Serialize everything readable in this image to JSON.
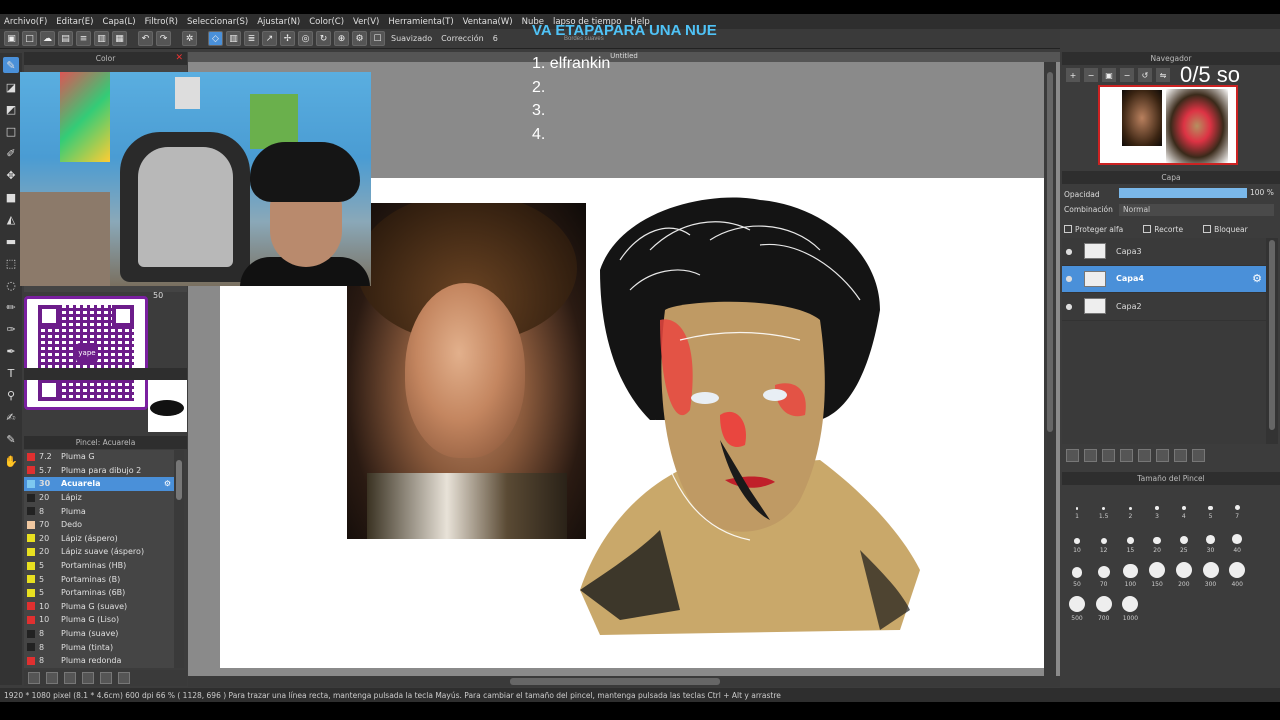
{
  "menu": [
    "Archivo(F)",
    "Editar(E)",
    "Capa(L)",
    "Filtro(R)",
    "Seleccionar(S)",
    "Ajustar(N)",
    "Color(C)",
    "Ver(V)",
    "Herramienta(T)",
    "Ventana(W)",
    "Nube",
    "lapso de tiempo",
    "Help"
  ],
  "toolbar": {
    "smoothing_label": "Suavizado",
    "correction_label": "Corrección",
    "correction_value": "6"
  },
  "color_panel": {
    "title": "Color"
  },
  "canvas": {
    "title": "Untitled"
  },
  "overlay": {
    "title": "VA ETAPAPARA UNA NUE",
    "subtitle": "Bordes suaves",
    "list": [
      "1. elfrankin",
      "2.",
      "3.",
      "4."
    ],
    "score": "0/5 so"
  },
  "qr": {
    "brand": "yape"
  },
  "brush_size_small": "50",
  "subtool_panel": {
    "title": "Pincel: Acuarela"
  },
  "brushes": [
    {
      "size": "7.2",
      "name": "Pluma G",
      "color": "#e03030"
    },
    {
      "size": "5.7",
      "name": "Pluma para dibujo 2",
      "color": "#e03030"
    },
    {
      "size": "30",
      "name": "Acuarela",
      "color": "#7ec8f0",
      "selected": true
    },
    {
      "size": "20",
      "name": "Lápiz",
      "color": "#222222"
    },
    {
      "size": "8",
      "name": "Pluma",
      "color": "#222222"
    },
    {
      "size": "70",
      "name": "Dedo",
      "color": "#f0c8a0"
    },
    {
      "size": "20",
      "name": "Lápiz (áspero)",
      "color": "#e8e020"
    },
    {
      "size": "20",
      "name": "Lápiz suave (áspero)",
      "color": "#e8e020"
    },
    {
      "size": "5",
      "name": "Portaminas (HB)",
      "color": "#e8e020"
    },
    {
      "size": "5",
      "name": "Portaminas (B)",
      "color": "#e8e020"
    },
    {
      "size": "5",
      "name": "Portaminas (6B)",
      "color": "#e8e020"
    },
    {
      "size": "10",
      "name": "Pluma G (suave)",
      "color": "#e03030"
    },
    {
      "size": "10",
      "name": "Pluma G (Liso)",
      "color": "#e03030"
    },
    {
      "size": "8",
      "name": "Pluma (suave)",
      "color": "#222222"
    },
    {
      "size": "8",
      "name": "Pluma (tinta)",
      "color": "#222222"
    },
    {
      "size": "8",
      "name": "Pluma redonda",
      "color": "#e03030"
    }
  ],
  "navigator": {
    "title": "Navegador"
  },
  "layers": {
    "title": "Capa",
    "opacity_label": "Opacidad",
    "opacity_value": "100 %",
    "opacity_fraction": 1.0,
    "blend_label": "Combinación",
    "blend_value": "Normal",
    "checks": [
      "Proteger alfa",
      "Recorte",
      "Bloquear"
    ],
    "items": [
      {
        "name": "Capa3"
      },
      {
        "name": "Capa4",
        "selected": true
      },
      {
        "name": "Capa2"
      }
    ]
  },
  "brush_size_panel": {
    "title": "Tamaño del Pincel",
    "sizes": [
      "1",
      "1.5",
      "2",
      "3",
      "4",
      "5",
      "7",
      "10",
      "12",
      "15",
      "20",
      "25",
      "30",
      "40",
      "50",
      "70",
      "100",
      "150",
      "200",
      "300",
      "400",
      "500",
      "700",
      "1000"
    ]
  },
  "status": {
    "text": "1920 * 1080 pixel  (8.1 * 4.6cm)  600 dpi   66 %   ( 1128, 696 )   Para trazar una línea recta, mantenga pulsada la tecla Mayús. Para cambiar el tamaño del pincel, mantenga pulsada las teclas Ctrl + Alt y arrastre"
  }
}
